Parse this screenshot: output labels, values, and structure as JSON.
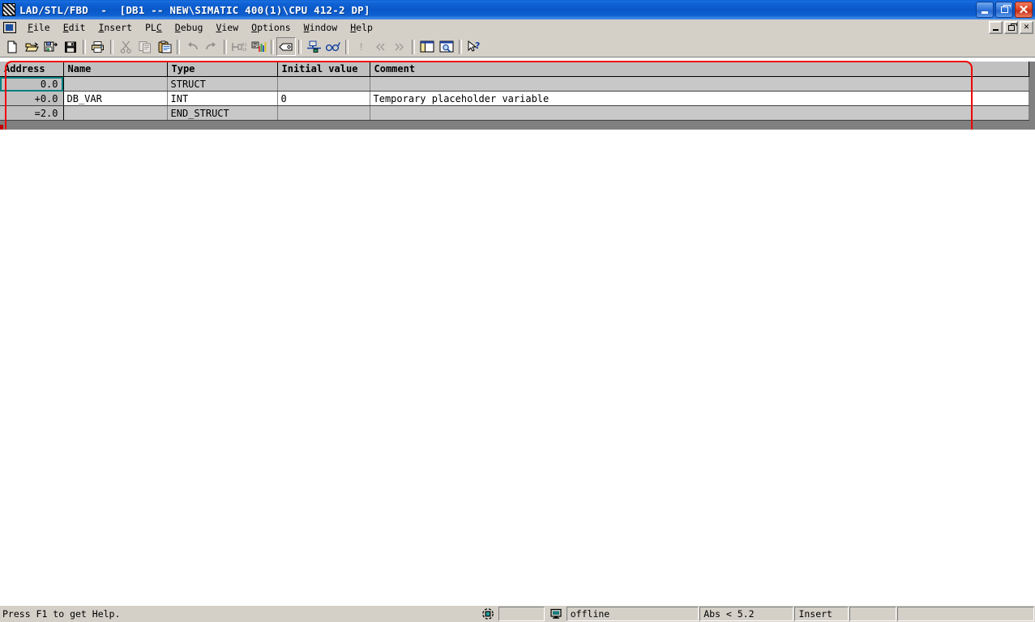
{
  "window": {
    "title": "LAD/STL/FBD  -  [DB1 -- NEW\\SIMATIC 400(1)\\CPU 412-2 DP]",
    "app_icon": "lad-stl-fbd-icon",
    "minimize_label": "",
    "restore_label": "",
    "close_label": "✕"
  },
  "menu": {
    "system_icon": "mdi-system-icon",
    "items": [
      {
        "pre": "",
        "accel": "F",
        "post": "ile"
      },
      {
        "pre": "",
        "accel": "E",
        "post": "dit"
      },
      {
        "pre": "",
        "accel": "I",
        "post": "nsert"
      },
      {
        "pre": "PL",
        "accel": "C",
        "post": ""
      },
      {
        "pre": "",
        "accel": "D",
        "post": "ebug"
      },
      {
        "pre": "",
        "accel": "V",
        "post": "iew"
      },
      {
        "pre": "",
        "accel": "O",
        "post": "ptions"
      },
      {
        "pre": "",
        "accel": "W",
        "post": "indow"
      },
      {
        "pre": "",
        "accel": "H",
        "post": "elp"
      }
    ],
    "mdi_minimize": "mdi-minimize",
    "mdi_restore": "mdi-restore",
    "mdi_close": "✕"
  },
  "toolbar": {
    "buttons": [
      {
        "name": "new-document-icon",
        "enabled": true,
        "sep_after": false
      },
      {
        "name": "open-folder-icon",
        "enabled": true,
        "sep_after": false
      },
      {
        "name": "save-as-icon",
        "enabled": true,
        "sep_after": false
      },
      {
        "name": "save-icon",
        "enabled": true,
        "sep_after": true
      },
      {
        "name": "print-icon",
        "enabled": true,
        "sep_after": true
      },
      {
        "name": "cut-scissors-icon",
        "enabled": false,
        "sep_after": false
      },
      {
        "name": "copy-icon",
        "enabled": false,
        "sep_after": false
      },
      {
        "name": "paste-icon",
        "enabled": true,
        "sep_after": true
      },
      {
        "name": "undo-arrow-icon",
        "enabled": false,
        "sep_after": false
      },
      {
        "name": "redo-arrow-icon",
        "enabled": false,
        "sep_after": true
      },
      {
        "name": "insert-network-icon",
        "enabled": false,
        "sep_after": false
      },
      {
        "name": "symbol-table-icon",
        "enabled": true,
        "sep_after": true
      },
      {
        "name": "toggle-comment-icon",
        "enabled": true,
        "sep_after": true,
        "pressed": true
      },
      {
        "name": "download-to-plc-icon",
        "enabled": true,
        "sep_after": false
      },
      {
        "name": "monitor-glasses-icon",
        "enabled": true,
        "sep_after": true
      },
      {
        "name": "breakpoint-icon",
        "enabled": false,
        "sep_after": false
      },
      {
        "name": "prev-error-icon",
        "enabled": false,
        "sep_after": false
      },
      {
        "name": "next-error-icon",
        "enabled": false,
        "sep_after": true
      },
      {
        "name": "overviews-pane-icon",
        "enabled": true,
        "sep_after": false
      },
      {
        "name": "details-pane-icon",
        "enabled": true,
        "sep_after": true
      },
      {
        "name": "context-help-icon",
        "enabled": true,
        "sep_after": false
      }
    ]
  },
  "declaration_table": {
    "columns": [
      "Address",
      "Name",
      "Type",
      "Initial value",
      "Comment"
    ],
    "rows": [
      {
        "kind": "struct",
        "selected_cell": "address",
        "address": "0.0",
        "name": "",
        "type": "STRUCT",
        "initial_value": "",
        "comment": ""
      },
      {
        "kind": "variable",
        "selected_cell": "",
        "address": "+0.0",
        "name": "DB_VAR",
        "type": "INT",
        "initial_value": "0",
        "comment": "Temporary placeholder variable"
      },
      {
        "kind": "struct",
        "selected_cell": "",
        "address": "=2.0",
        "name": "",
        "type": "END_STRUCT",
        "initial_value": "",
        "comment": ""
      }
    ]
  },
  "annotation": {
    "shape": "red-rounded-rectangle",
    "color": "#ee0000"
  },
  "statusbar": {
    "message": "Press F1 to get Help.",
    "network_icon": "network-status-icon",
    "panel_blank_1": "",
    "monitor_icon": "plc-monitor-icon",
    "connection": "offline",
    "position": "Abs < 5.2",
    "insert_mode": "Insert",
    "panel_blank_2": "",
    "panel_blank_3": ""
  },
  "colors": {
    "title_bar": "#0a58c8",
    "chrome": "#d4d0c8",
    "header_cell": "#c0c0c0",
    "struct_row": "#c8c8c8",
    "selection_outline": "#008080",
    "annotation_red": "#ee0000",
    "table_frame": "#808080"
  }
}
